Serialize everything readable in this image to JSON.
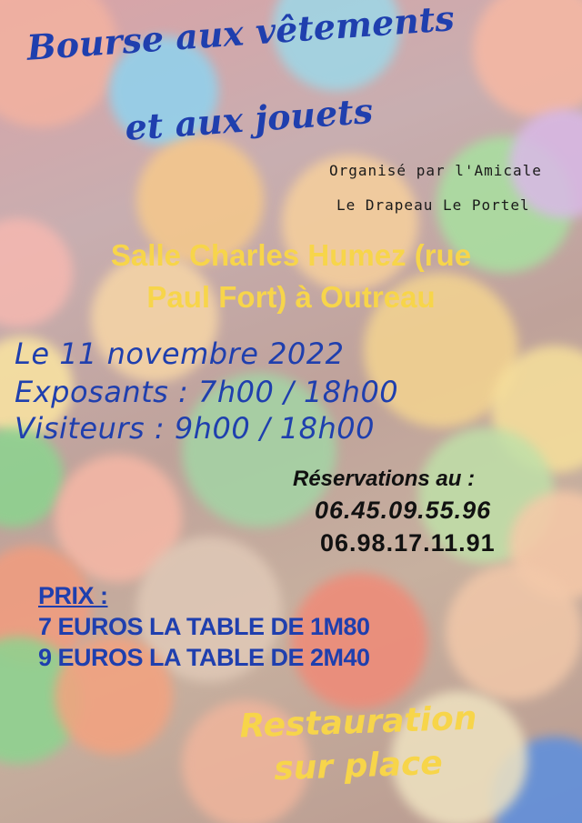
{
  "poster": {
    "title_line1": "Bourse aux vêtements",
    "title_line2": "et aux jouets",
    "organizer_line1": "Organisé par l'Amicale",
    "organizer_line2": "Le Drapeau Le Portel",
    "venue_line1": "Salle Charles Humez (rue",
    "venue_line2": "Paul Fort) à Outreau",
    "date": "Le 11 novembre 2022",
    "exhibitors": "Exposants : 7h00 / 18h00",
    "visitors": "Visiteurs : 9h00 / 18h00",
    "reservations_label": "Réservations au :",
    "phone1": "06.45.09.55.96",
    "phone2": "06.98.17.11.91",
    "price_label": "PRIX :",
    "price1": "7 EUROS LA TABLE DE 1M80",
    "price2": "9 EUROS LA TABLE DE 2M40",
    "food_line1": "Restauration",
    "food_line2": "sur place"
  },
  "colors": {
    "title_blue": "#1f3fae",
    "accent_yellow": "#f7d54a",
    "text_black": "#111111"
  }
}
